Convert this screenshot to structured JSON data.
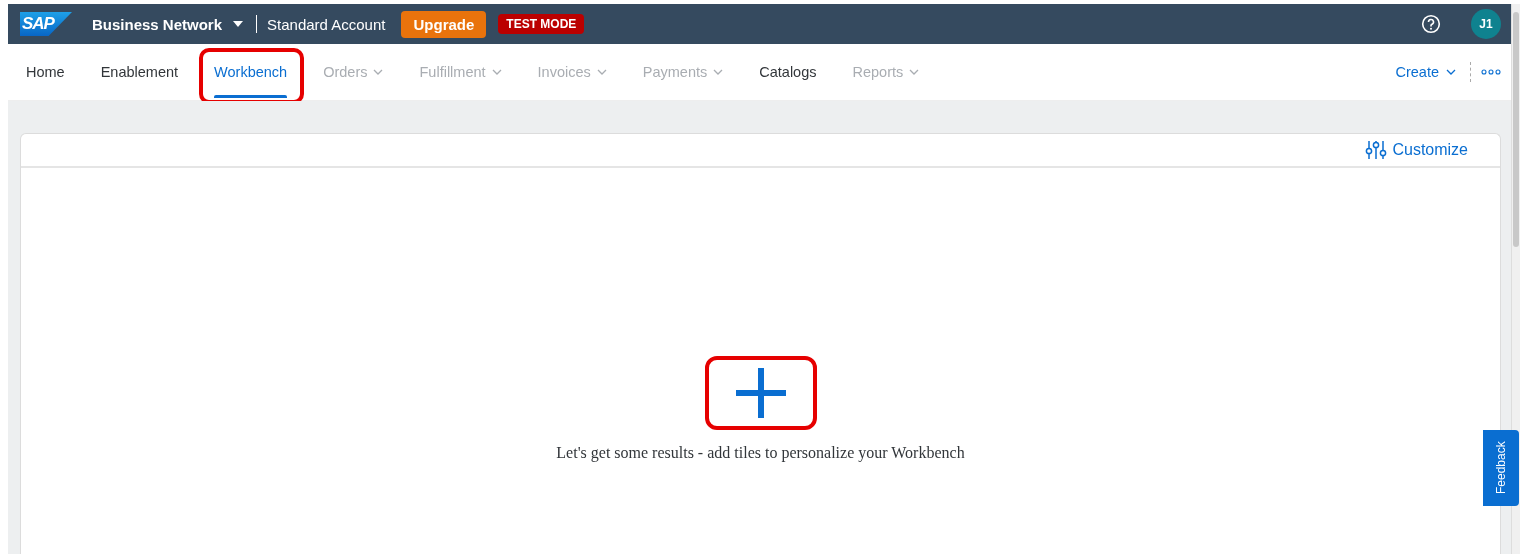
{
  "header": {
    "logo": "SAP",
    "product": "Business Network",
    "account": "Standard Account",
    "upgrade": "Upgrade",
    "mode_badge": "TEST MODE",
    "avatar": "J1"
  },
  "tabs": [
    {
      "label": "Home",
      "selected": false,
      "disabled": false,
      "dropdown": false,
      "highlighted": false
    },
    {
      "label": "Enablement",
      "selected": false,
      "disabled": false,
      "dropdown": false,
      "highlighted": false
    },
    {
      "label": "Workbench",
      "selected": true,
      "disabled": false,
      "dropdown": false,
      "highlighted": true
    },
    {
      "label": "Orders",
      "selected": false,
      "disabled": true,
      "dropdown": true,
      "highlighted": false
    },
    {
      "label": "Fulfillment",
      "selected": false,
      "disabled": true,
      "dropdown": true,
      "highlighted": false
    },
    {
      "label": "Invoices",
      "selected": false,
      "disabled": true,
      "dropdown": true,
      "highlighted": false
    },
    {
      "label": "Payments",
      "selected": false,
      "disabled": true,
      "dropdown": true,
      "highlighted": false
    },
    {
      "label": "Catalogs",
      "selected": false,
      "disabled": false,
      "dropdown": false,
      "highlighted": false
    },
    {
      "label": "Reports",
      "selected": false,
      "disabled": true,
      "dropdown": true,
      "highlighted": false
    }
  ],
  "create": "Create",
  "workbench": {
    "customize": "Customize",
    "add_highlighted": true,
    "empty_message": "Let's get some results - add tiles to personalize your Workbench"
  },
  "feedback": "Feedback"
}
